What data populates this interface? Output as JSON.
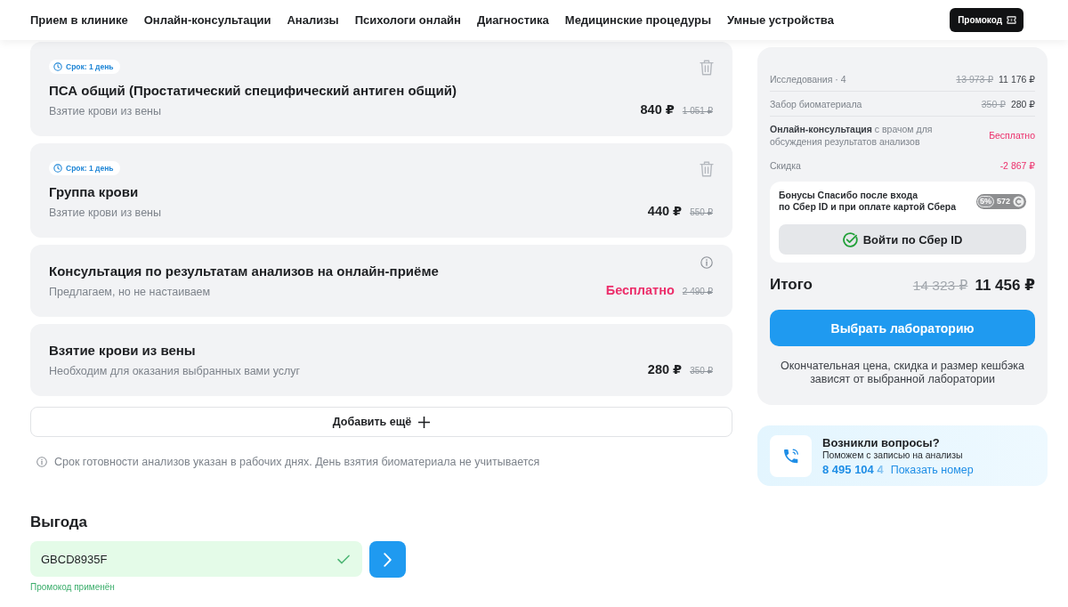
{
  "nav": {
    "items": [
      "Прием в клинике",
      "Онлайн-консультации",
      "Анализы",
      "Психологи онлайн",
      "Диагностика",
      "Медицинские процедуры",
      "Умные устройства"
    ],
    "promo_button": "Промокод"
  },
  "cart": {
    "items": [
      {
        "term": "Срок: 1 день",
        "title": "ПСА общий (Простатический специфический антиген общий)",
        "subtitle": "Взятие крови из вены",
        "price": "840 ₽",
        "old_price": "1 051 ₽",
        "free": false,
        "removable": true,
        "info": false
      },
      {
        "term": "Срок: 1 день",
        "title": "Группа крови",
        "subtitle": "Взятие крови из вены",
        "price": "440 ₽",
        "old_price": "550 ₽",
        "free": false,
        "removable": true,
        "info": false
      },
      {
        "title": "Консультация по результатам анализов на онлайн-приёме",
        "subtitle": "Предлагаем, но не настаиваем",
        "price": "Бесплатно",
        "old_price": "2 490 ₽",
        "free": true,
        "removable": false,
        "info": true
      },
      {
        "title": "Взятие крови из вены",
        "subtitle": "Необходим для оказания выбранных вами услуг",
        "price": "280 ₽",
        "old_price": "350 ₽",
        "free": false,
        "removable": false,
        "info": false
      }
    ],
    "add_button": "Добавить ещё",
    "note": "Срок готовности анализов указан в рабочих днях. День взятия биоматериала не учитывается"
  },
  "benefit": {
    "title": "Выгода",
    "promo_field": {
      "value": "GBCD8935F",
      "applied": true
    },
    "status": "Промокод применён"
  },
  "summary": {
    "rows": [
      {
        "label": "Исследования · 4",
        "old_value": "13 973 ₽",
        "value": "11 176 ₽",
        "accent": false
      },
      {
        "label": "Забор биоматериала",
        "old_value": "350 ₽",
        "value": "280 ₽",
        "accent": false
      },
      {
        "label": "**Онлайн-консультация** с врачом для обсуждения результатов анализов",
        "value": "Бесплатно",
        "accent": true
      },
      {
        "label": "Скидка",
        "value": "-2 867 ₽",
        "accent": true
      }
    ],
    "bonus": {
      "text_lines": [
        "Бонусы Спасибо после входа",
        "по Сбер ID и при оплате картой Сбера"
      ],
      "percent": "5%",
      "amount": "572",
      "login_button": "Войти по Сбер ID"
    },
    "total": {
      "label": "Итого",
      "old_value": "14 323 ₽",
      "value": "11 456 ₽"
    },
    "choose_button": "Выбрать лабораторию",
    "note": "Окончательная цена, скидка и размер кешбэка зависят от выбранной лаборатории"
  },
  "contact": {
    "title": "Возникли вопросы?",
    "subtitle": "Поможем с записью на анализы",
    "phone": "8 495 104 4",
    "link": "Показать номер"
  }
}
